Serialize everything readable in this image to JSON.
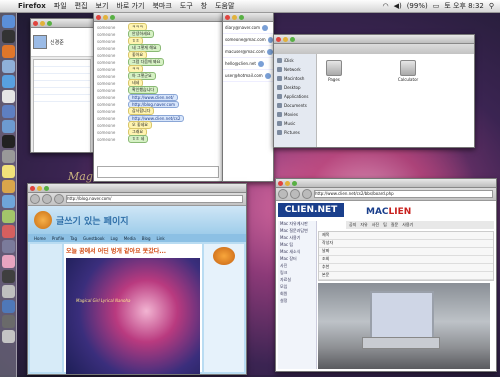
{
  "menubar": {
    "apple": "",
    "app": "Firefox",
    "items": [
      "파일",
      "편집",
      "보기",
      "바로 가기",
      "북마크",
      "도구",
      "창",
      "도움말"
    ],
    "battery": "(99%)",
    "clock": "토 오후 8:32"
  },
  "wallpaper": {
    "text": "Magica"
  },
  "buddy": {
    "name": "신경준"
  },
  "chat": {
    "messages": [
      {
        "who": "someone",
        "text": "ㅋㅋㅋ",
        "style": "y"
      },
      {
        "who": "someone",
        "text": "안녕하세요",
        "style": "g"
      },
      {
        "who": "someone",
        "text": "ㅎㅎ",
        "style": "y"
      },
      {
        "who": "someone",
        "text": "네 그렇게 해요",
        "style": "g"
      },
      {
        "who": "someone",
        "text": "좋아요",
        "style": "y"
      },
      {
        "who": "someone",
        "text": "그럼 다음에 봐요",
        "style": "g"
      },
      {
        "who": "someone",
        "text": "ㅋㅋ",
        "style": "y"
      },
      {
        "who": "someone",
        "text": "아 그렇군요",
        "style": "g"
      },
      {
        "who": "someone",
        "text": "네네",
        "style": "y"
      },
      {
        "who": "someone",
        "text": "확인했습니다",
        "style": "g"
      },
      {
        "who": "someone",
        "text": "http://www.clien.net/",
        "style": "b"
      },
      {
        "who": "someone",
        "text": "http://blog.naver.com",
        "style": "b"
      },
      {
        "who": "someone",
        "text": "감사합니다",
        "style": "y"
      },
      {
        "who": "someone",
        "text": "http://www.clien.net/cs2",
        "style": "b"
      },
      {
        "who": "someone",
        "text": "오 좋네요",
        "style": "y"
      },
      {
        "who": "someone",
        "text": "그래요",
        "style": "y"
      },
      {
        "who": "someone",
        "text": "ㅎㅎ 네",
        "style": "g"
      }
    ]
  },
  "contacts": [
    "diary@naver.com",
    "someone@mac.com",
    "macuser@mac.com",
    "hello@clien.net",
    "user@hotmail.com"
  ],
  "finder": {
    "sidebar": [
      "iDisk",
      "Network",
      "Macintosh",
      "Desktop",
      "Applications",
      "Documents",
      "Movies",
      "Music",
      "Pictures"
    ],
    "files": [
      "Pages",
      "Calculator"
    ]
  },
  "blog": {
    "url": "http://blog.naver.com/",
    "title": "글쓰기 있는 페이지",
    "nav": [
      "Home",
      "Profile",
      "Tag",
      "Guestbook",
      "Log",
      "Media",
      "Blog",
      "Link"
    ],
    "post_title": "오늘 꿈에서 어딘 벙개 같아요 못갔다...",
    "picture_caption": "Magical Girl Lyrical Nanoha"
  },
  "clien": {
    "url": "http://www.clien.net/cs2/bbs/board.php",
    "logo": "CLIEN.NET",
    "logo2_a": "MAC",
    "logo2_b": "LIEN",
    "menu": [
      "공지",
      "자유",
      "사진",
      "팁",
      "질문",
      "사용기"
    ],
    "side": [
      "Mac 자유게시판",
      "Mac 질문과답변",
      "Mac 사용기",
      "Mac 팁",
      "Mac 새소식",
      "Mac 장터",
      "사진",
      "링크",
      "자료실",
      "모임",
      "회원",
      "설정"
    ],
    "rows": [
      "제목",
      "작성자",
      "날짜",
      "조회",
      "추천",
      "본문"
    ]
  }
}
